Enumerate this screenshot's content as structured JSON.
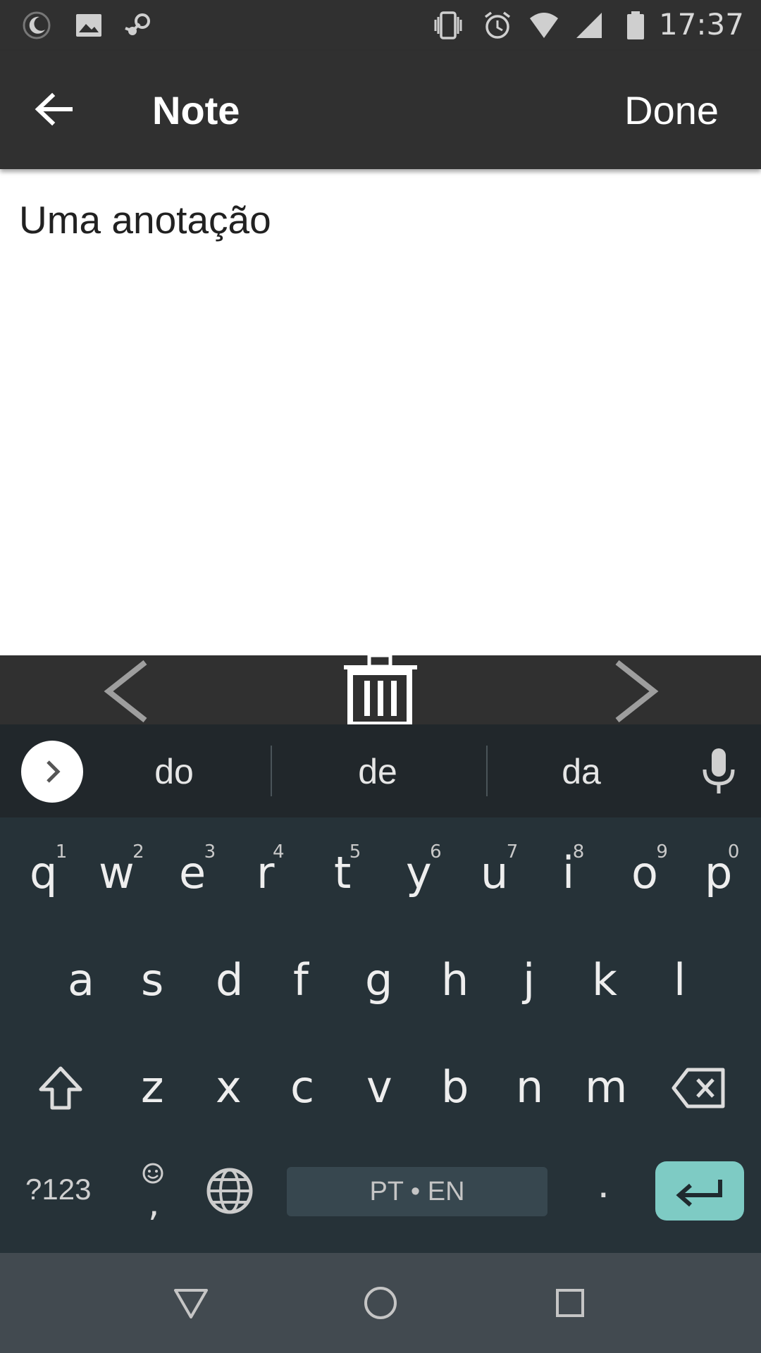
{
  "status_bar": {
    "time": "17:37",
    "left_icons": [
      "moon-icon",
      "image-icon",
      "steam-icon"
    ],
    "right_icons": [
      "vibrate-icon",
      "alarm-icon",
      "wifi-icon",
      "signal-icon",
      "battery-icon"
    ]
  },
  "app_bar": {
    "title": "Note",
    "done_label": "Done",
    "back_icon": "arrow-left-icon"
  },
  "note": {
    "text": "Uma anotação"
  },
  "toolbar": {
    "icons": [
      "chevron-left-icon",
      "trash-icon",
      "chevron-right-icon"
    ]
  },
  "keyboard": {
    "suggestions": [
      "do",
      "de",
      "da"
    ],
    "row1": [
      {
        "key": "q",
        "hint": "1"
      },
      {
        "key": "w",
        "hint": "2"
      },
      {
        "key": "e",
        "hint": "3"
      },
      {
        "key": "r",
        "hint": "4"
      },
      {
        "key": "t",
        "hint": "5"
      },
      {
        "key": "y",
        "hint": "6"
      },
      {
        "key": "u",
        "hint": "7"
      },
      {
        "key": "i",
        "hint": "8"
      },
      {
        "key": "o",
        "hint": "9"
      },
      {
        "key": "p",
        "hint": "0"
      }
    ],
    "row2": [
      "a",
      "s",
      "d",
      "f",
      "g",
      "h",
      "j",
      "k",
      "l"
    ],
    "row3": [
      "z",
      "x",
      "c",
      "v",
      "b",
      "n",
      "m"
    ],
    "symbols_label": "?123",
    "emoji_comma": ",",
    "space_label": "PT • EN",
    "period": ".",
    "accent_color": "#7ecbc4"
  },
  "nav_bar": {
    "icons": [
      "back-triangle-icon",
      "home-circle-icon",
      "recents-square-icon"
    ]
  }
}
